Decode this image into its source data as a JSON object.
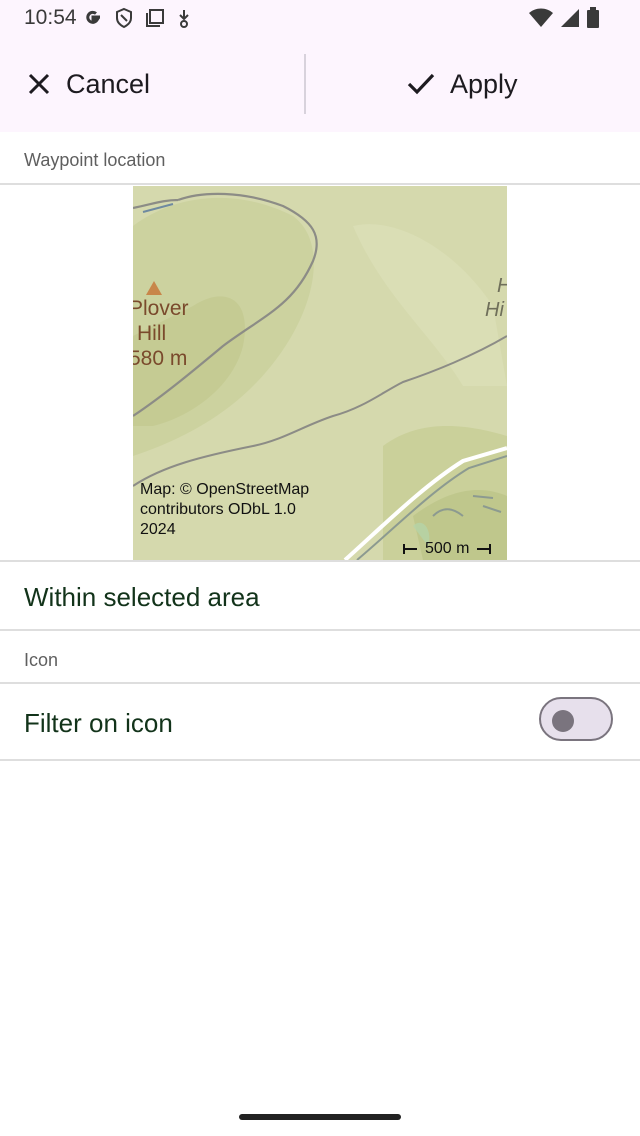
{
  "status_bar": {
    "time": "10:54",
    "left_icons": [
      "google-icon",
      "shield-icon",
      "copy-icon",
      "download-icon"
    ],
    "right_icons": [
      "wifi-icon",
      "signal-icon",
      "battery-icon"
    ]
  },
  "action_bar": {
    "cancel_label": "Cancel",
    "apply_label": "Apply"
  },
  "sections": {
    "waypoint_location_label": "Waypoint location",
    "icon_label": "Icon"
  },
  "map": {
    "place_name_line1": "Plover",
    "place_name_line2": "Hill",
    "place_height": "580 m",
    "edge_label_line1": "H",
    "edge_label_line2": "Hi",
    "attribution": "Map: © OpenStreetMap contributors ODbL 1.0 2024",
    "scale": "500 m"
  },
  "rows": {
    "within_area": "Within selected area",
    "filter_icon": "Filter on icon"
  },
  "toggle": {
    "filter_on_icon_enabled": false
  },
  "colors": {
    "top_bar_background": "#fdf5fe",
    "row_text": "#12331a",
    "map_green": "#d5d9ad",
    "peak_marker": "#c8864a"
  }
}
